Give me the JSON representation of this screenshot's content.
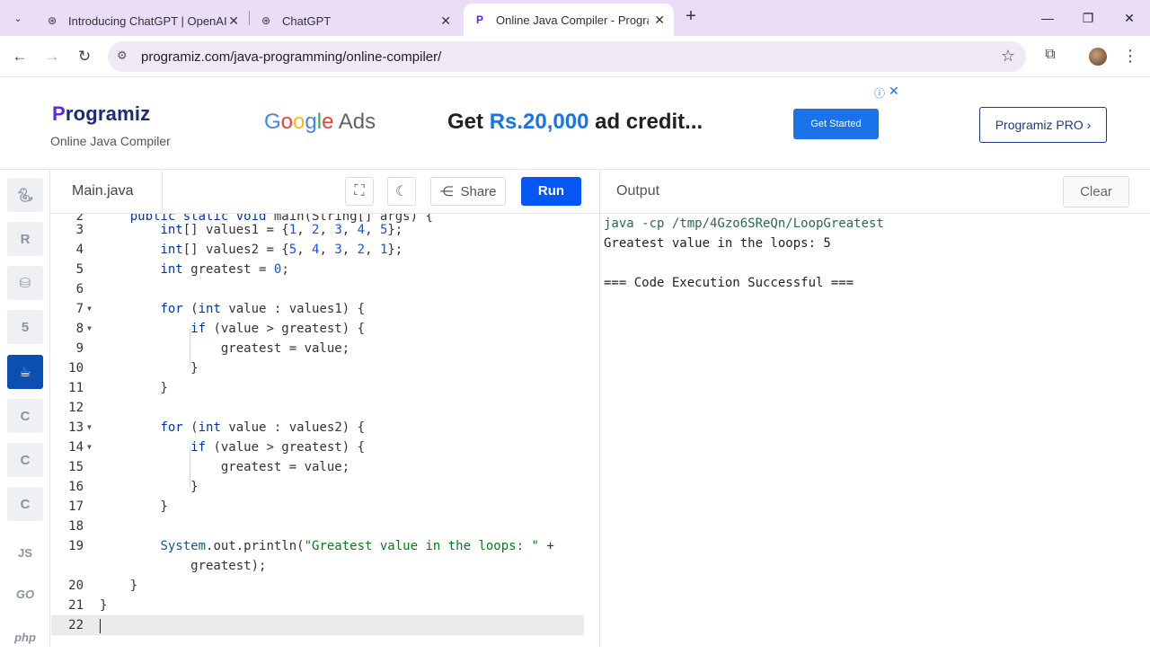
{
  "browser": {
    "tabs": [
      {
        "title": "Introducing ChatGPT | OpenAI",
        "favicon": "openai-icon"
      },
      {
        "title": "ChatGPT",
        "favicon": "openai-icon"
      },
      {
        "title": "Online Java Compiler - Program",
        "favicon": "programiz-icon",
        "active": true
      }
    ],
    "url": "programiz.com/java-programming/online-compiler/"
  },
  "header": {
    "logo": "rogramiz",
    "logo_initial": "P",
    "subtitle": "Online Java Compiler",
    "ad": {
      "brand": "Google Ads",
      "headline_prefix": "Get ",
      "amount": "Rs.20,000",
      "headline_suffix": " ad credit...",
      "cta": "Get Started"
    },
    "pro_label": "Programiz PRO ›"
  },
  "sidebar": {
    "languages": [
      {
        "name": "python",
        "icon": "python-icon"
      },
      {
        "name": "r",
        "icon": "r-icon"
      },
      {
        "name": "sql",
        "icon": "database-icon"
      },
      {
        "name": "html",
        "icon": "html5-icon"
      },
      {
        "name": "java",
        "icon": "java-icon",
        "active": true
      },
      {
        "name": "c",
        "icon": "c-icon"
      },
      {
        "name": "cpp",
        "icon": "cpp-icon"
      },
      {
        "name": "csharp",
        "icon": "csharp-icon"
      },
      {
        "name": "js",
        "label": "JS"
      },
      {
        "name": "go",
        "label": "GO"
      },
      {
        "name": "php",
        "label": "php"
      }
    ]
  },
  "editor": {
    "file_name": "Main.java",
    "share_label": "Share",
    "run_label": "Run",
    "current_line": 22
  },
  "output": {
    "title": "Output",
    "clear_label": "Clear",
    "lines": [
      "java -cp /tmp/4Gzo6SReQn/LoopGreatest",
      "Greatest value in the loops: 5",
      "",
      "=== Code Execution Successful ==="
    ]
  },
  "colors": {
    "tabstrip": "#e9ddf7",
    "run_button": "#0556f3",
    "active_language": "#0b4fb3",
    "ad_cta": "#1a73e8"
  }
}
